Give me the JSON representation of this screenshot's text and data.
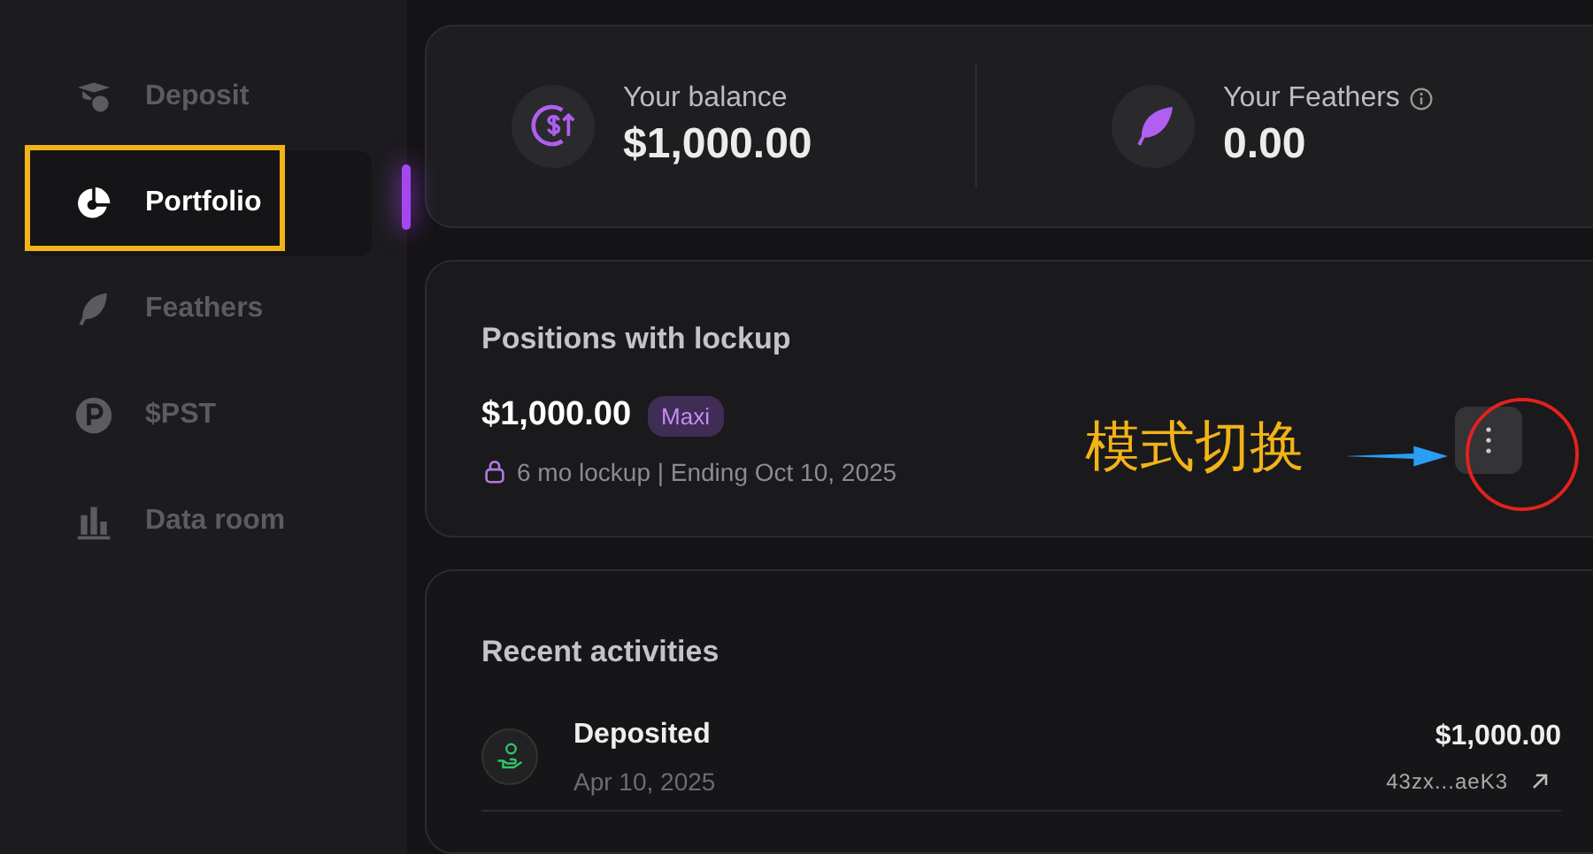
{
  "sidebar": {
    "items": [
      {
        "label": "Deposit",
        "kind": "deposit",
        "selected": false
      },
      {
        "label": "Portfolio",
        "kind": "pie",
        "selected": true
      },
      {
        "label": "Feathers",
        "kind": "feather",
        "selected": false
      },
      {
        "label": "$PST",
        "kind": "coin",
        "selected": false
      },
      {
        "label": "Data room",
        "kind": "bars",
        "selected": false
      }
    ]
  },
  "summary": [
    {
      "label": "Your balance",
      "value": "$1,000.00",
      "kind": "dollar",
      "info": false
    },
    {
      "label": "Your Feathers",
      "value": "0.00",
      "kind": "feather",
      "info": true
    }
  ],
  "positions": {
    "title": "Positions with lockup",
    "items": [
      {
        "amount": "$1,000.00",
        "badge": "Maxi",
        "details": "6 mo lockup | Ending Oct 10, 2025"
      }
    ]
  },
  "activities": {
    "title": "Recent activities",
    "items": [
      {
        "title": "Deposited",
        "date": "Apr 10, 2025",
        "amount": "$1,000.00",
        "tx": "43zx...aeK3"
      }
    ]
  },
  "annotation": {
    "label": "模式切换"
  }
}
